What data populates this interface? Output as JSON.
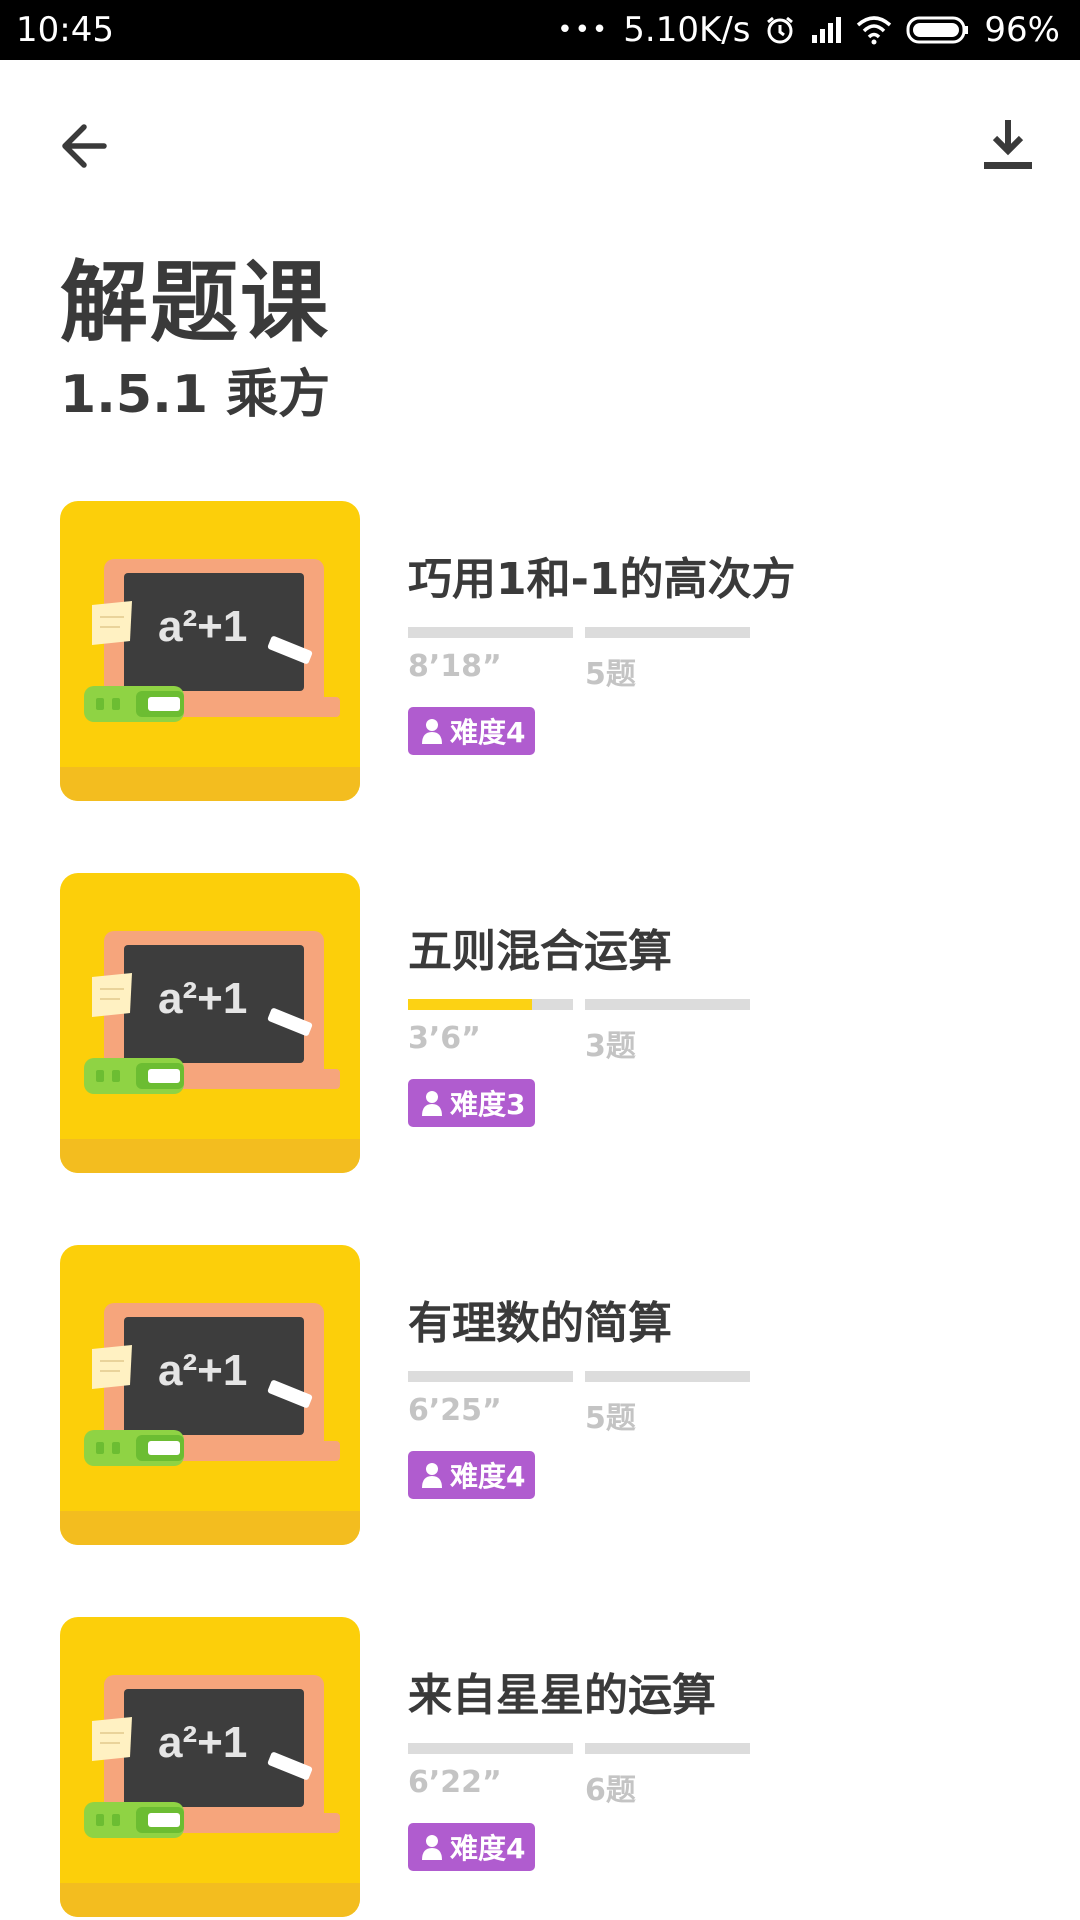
{
  "status_bar": {
    "time": "10:45",
    "dots": "•••",
    "network_speed": "5.10K/s",
    "battery": "96%",
    "icons": [
      "alarm-icon",
      "signal-icon",
      "wifi-icon",
      "battery-icon"
    ]
  },
  "header": {
    "back_icon": "arrow-left-icon",
    "download_icon": "download-icon",
    "title": "解题课",
    "subtitle": "1.5.1 乘方"
  },
  "colors": {
    "thumb_bg": "#fccf0a",
    "badge": "#b05ccf",
    "progress": "#fcd214",
    "track": "#dcdcdc",
    "text": "#3a3a3a",
    "meta": "#c4c4c4"
  },
  "thumbnail": {
    "formula": "a²+1",
    "icon": "blackboard-icon"
  },
  "courses": [
    {
      "title": "巧用1和-1的高次方",
      "duration": "8’18”",
      "questions": "5题",
      "difficulty": "难度4",
      "progress": 0
    },
    {
      "title": "五则混合运算",
      "duration": "3’6”",
      "questions": "3题",
      "difficulty": "难度3",
      "progress": 0.75
    },
    {
      "title": "有理数的简算",
      "duration": "6’25”",
      "questions": "5题",
      "difficulty": "难度4",
      "progress": 0
    },
    {
      "title": "来自星星的运算",
      "duration": "6’22”",
      "questions": "6题",
      "difficulty": "难度4",
      "progress": 0
    }
  ]
}
